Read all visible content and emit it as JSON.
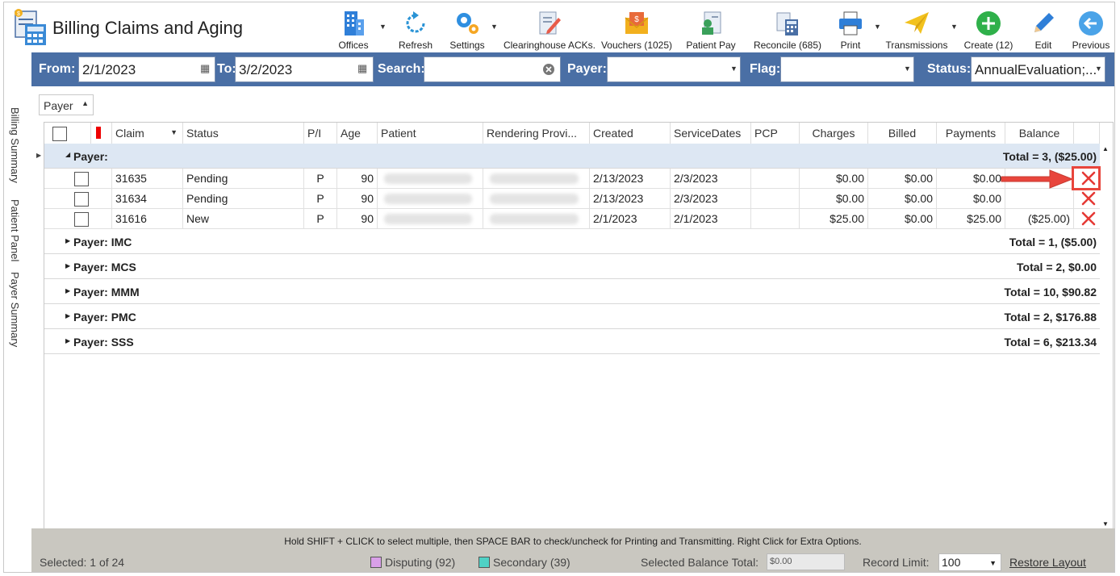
{
  "app": {
    "title": "Billing Claims and Aging"
  },
  "toolbar": {
    "offices": "Offices",
    "refresh": "Refresh",
    "settings": "Settings",
    "clearinghouse": "Clearinghouse ACKs.",
    "vouchers": "Vouchers (1025)",
    "patient_pay": "Patient Pay",
    "reconcile": "Reconcile (685)",
    "print": "Print",
    "transmissions": "Transmissions",
    "create": "Create (12)",
    "edit": "Edit",
    "previous": "Previous"
  },
  "side_tabs": [
    "Billing Summary",
    "Patient Panel",
    "Payer Summary"
  ],
  "filters": {
    "from_label": "From:",
    "from_value": "2/1/2023",
    "to_label": "To:",
    "to_value": "3/2/2023",
    "search_label": "Search:",
    "search_value": "",
    "payer_label": "Payer:",
    "payer_value": "",
    "flag_label": "Flag:",
    "flag_value": "",
    "status_label": "Status:",
    "status_value": "AnnualEvaluation;..."
  },
  "grouping": {
    "label": "Payer"
  },
  "columns": [
    "Claim",
    "Status",
    "P/I",
    "Age",
    "Patient",
    "Rendering Provi...",
    "Created",
    "ServiceDates",
    "PCP",
    "Charges",
    "Billed",
    "Payments",
    "Balance"
  ],
  "expanded_group": {
    "title": "Payer:",
    "summary": "Total = 3,  ($25.00)",
    "rows": [
      {
        "claim": "31635",
        "status": "Pending",
        "pi": "P",
        "age": "90",
        "created": "2/13/2023",
        "service": "2/3/2023",
        "charges": "$0.00",
        "billed": "$0.00",
        "payments": "$0.00",
        "balance": ""
      },
      {
        "claim": "31634",
        "status": "Pending",
        "pi": "P",
        "age": "90",
        "created": "2/13/2023",
        "service": "2/3/2023",
        "charges": "$0.00",
        "billed": "$0.00",
        "payments": "$0.00",
        "balance": ""
      },
      {
        "claim": "31616",
        "status": "New",
        "pi": "P",
        "age": "90",
        "created": "2/1/2023",
        "service": "2/1/2023",
        "charges": "$25.00",
        "billed": "$0.00",
        "payments": "$25.00",
        "balance": "($25.00)"
      }
    ]
  },
  "groups": [
    {
      "title": "Payer: IMC",
      "summary": "Total = 1,  ($5.00)"
    },
    {
      "title": "Payer: MCS",
      "summary": "Total = 2,  $0.00"
    },
    {
      "title": "Payer: MMM",
      "summary": "Total = 10,  $90.82"
    },
    {
      "title": "Payer: PMC",
      "summary": "Total = 2,  $176.88"
    },
    {
      "title": "Payer: SSS",
      "summary": "Total = 6,  $213.34"
    }
  ],
  "footer": {
    "hint": "Hold SHIFT + CLICK to select multiple, then SPACE BAR to check/uncheck for Printing and Transmitting. Right Click for Extra Options.",
    "selected": "Selected: 1 of 24",
    "disputing": "Disputing (92)",
    "secondary": "Secondary (39)",
    "balance_label": "Selected Balance Total:",
    "balance_value": "$0.00",
    "limit_label": "Record Limit:",
    "limit_value": "100",
    "restore": "Restore Layout"
  },
  "colors": {
    "filterbar": "#4a6fa5",
    "delete": "#e53935",
    "arrow": "#e8453c",
    "disputing": "#d9a0e8",
    "secondary": "#4fd1c5"
  }
}
